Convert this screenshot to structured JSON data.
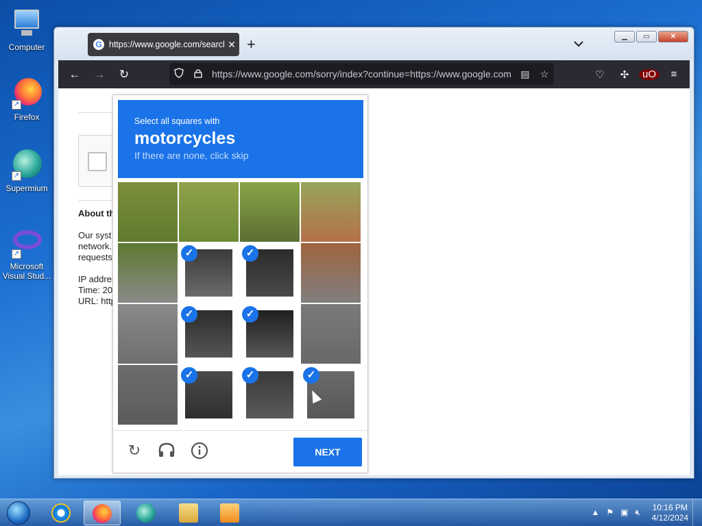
{
  "desktop": {
    "icons": [
      {
        "label": "Computer"
      },
      {
        "label": "Firefox"
      },
      {
        "label": "Supermium"
      },
      {
        "label": "Microsoft Visual Stud..."
      }
    ]
  },
  "browser": {
    "tab_title": "https://www.google.com/search",
    "tab_favicon": "G",
    "new_tab_label": "+",
    "tab_list_label": "⌄",
    "url": "https://www.google.com/sorry/index?continue=https://www.google.com"
  },
  "page": {
    "heading": "About th",
    "text_lines": [
      "Our syst",
      "network.",
      "requests"
    ],
    "info_lines": [
      "IP addres",
      "Time: 20",
      "URL: http"
    ]
  },
  "captcha": {
    "instruction": "Select all squares with",
    "target": "motorcycles",
    "hint": "If there are none, click skip",
    "selected_tiles": [
      5,
      6,
      9,
      10,
      13,
      14,
      15
    ],
    "next_label": "NEXT"
  },
  "taskbar": {
    "time": "10:16 PM",
    "date": "4/12/2024"
  }
}
